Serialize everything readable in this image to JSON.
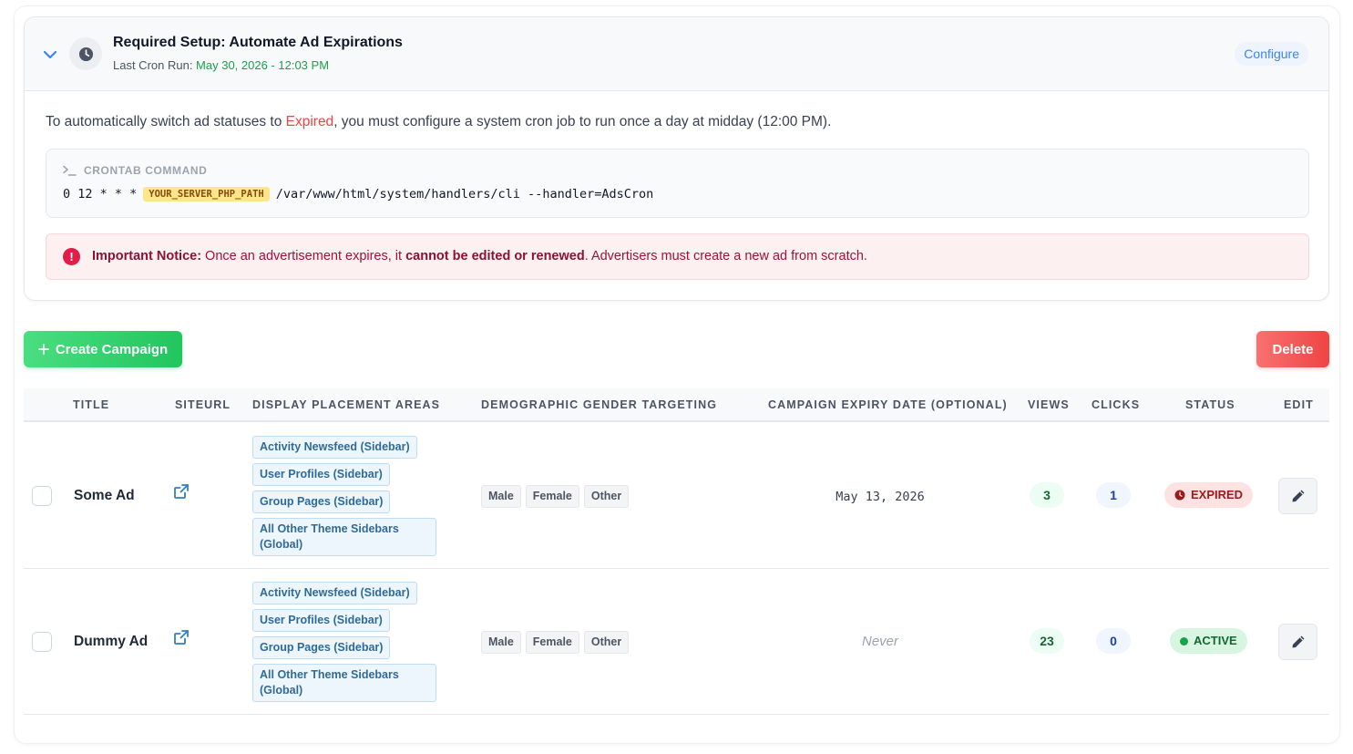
{
  "setup": {
    "title": "Required Setup: Automate Ad Expirations",
    "last_run_label": "Last Cron Run: ",
    "last_run_value": "May 30, 2026 - 12:03 PM",
    "configure_label": "Configure",
    "info_before": "To automatically switch ad statuses to ",
    "info_highlight": "Expired",
    "info_after": ", you must configure a system cron job to run once a day at midday (12:00 PM).",
    "crontab_label": "CRONTAB COMMAND",
    "cron_schedule": "0 12 * * *",
    "cron_placeholder": "YOUR_SERVER_PHP_PATH",
    "cron_command": "/var/www/html/system/handlers/cli --handler=AdsCron",
    "notice_strong": "Important Notice:",
    "notice_mid": " Once an advertisement expires, it ",
    "notice_bold": "cannot be edited or renewed",
    "notice_end": ". Advertisers must create a new ad from scratch."
  },
  "actions": {
    "create_label": "Create Campaign",
    "delete_label": "Delete"
  },
  "table": {
    "headers": {
      "title": "TITLE",
      "siteurl": "SITEURL",
      "placements": "DISPLAY PLACEMENT AREAS",
      "gender": "DEMOGRAPHIC GENDER TARGETING",
      "expiry": "CAMPAIGN EXPIRY DATE (OPTIONAL)",
      "views": "VIEWS",
      "clicks": "CLICKS",
      "status": "STATUS",
      "edit": "EDIT"
    },
    "rows": [
      {
        "title": "Some Ad",
        "placements": [
          "Activity Newsfeed (Sidebar)",
          "User Profiles (Sidebar)",
          "Group Pages (Sidebar)",
          "All Other Theme Sidebars (Global)"
        ],
        "genders": [
          "Male",
          "Female",
          "Other"
        ],
        "expiry": "May 13, 2026",
        "views": "3",
        "clicks": "1",
        "status": "EXPIRED"
      },
      {
        "title": "Dummy Ad",
        "placements": [
          "Activity Newsfeed (Sidebar)",
          "User Profiles (Sidebar)",
          "Group Pages (Sidebar)",
          "All Other Theme Sidebars (Global)"
        ],
        "genders": [
          "Male",
          "Female",
          "Other"
        ],
        "expiry": "Never",
        "views": "23",
        "clicks": "0",
        "status": "ACTIVE"
      }
    ]
  },
  "colors": {
    "create": "#22c55e",
    "delete": "#ef4444",
    "expired_text": "#ef4444",
    "cron_run_date": "#16a34a",
    "accent": "#3b82f6"
  }
}
